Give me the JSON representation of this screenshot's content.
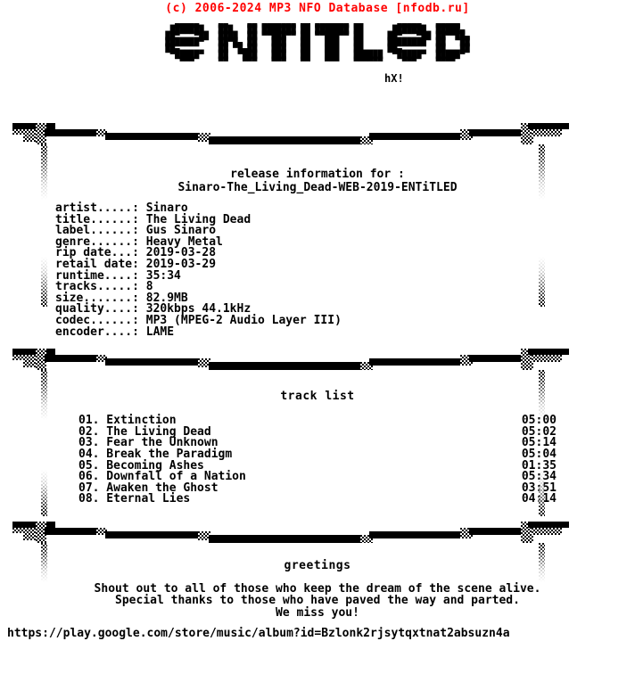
{
  "header": {
    "copyright": "(c) 2006-2024 MP3 NFO Database [nfodb.ru]",
    "color": "#ff0000"
  },
  "logo": {
    "group_name": "ENTiTLED",
    "signature": "hX!",
    "art": [
      "  ▄▄▄▄▄    ▄▄    ▄▄ ▄▄▄▄▄▄▄ ▄▄ ▄▄▄▄▄▄▄ ▄▄       ▄▄▄▄▄   ▄▄▄▄▄  ",
      " ███████   ███   ██ ███████ ██ ███████ ██      ███████  █████▄ ",
      "██▀   ▀██  ████  ██ ▀▀███▀▀ ██ ▀▀███▀▀ ██     ██▀   ▀██ ██▀▀██▄",
      "███████▀   ██▀█▄ ██   ███   ██   ███   ██     ████████  ██   ██",
      "██▄        ██ ▀█▄██   ███   ██   ███   ██     ██▄       ██   ██",
      " ▀█████▀   ██  ▀███   ███   ██   ███   ██████  ▀█████▀  █████▀ ",
      "   ▀▀▀     ▀▀   ▀▀▀   ▀▀▀   ▀▀   ▀▀▀   ▀▀▀▀▀▀    ▀▀▀    ▀▀▀▀   "
    ]
  },
  "release": {
    "section_label": "release information for :",
    "release_name": "Sinaro-The_Living_Dead-WEB-2019-ENTiTLED"
  },
  "info": {
    "rows": [
      {
        "key": "artist.....:",
        "value": "Sinaro"
      },
      {
        "key": "title......:",
        "value": "The Living Dead"
      },
      {
        "key": "label......:",
        "value": "Gus Sinaro"
      },
      {
        "key": "genre......:",
        "value": "Heavy Metal"
      },
      {
        "key": "rip date...:",
        "value": "2019-03-28"
      },
      {
        "key": "retail date:",
        "value": "2019-03-29"
      },
      {
        "key": "runtime....:",
        "value": "35:34"
      },
      {
        "key": "tracks.....:",
        "value": "8"
      },
      {
        "key": "size.......:",
        "value": "82.9MB"
      },
      {
        "key": "quality....:",
        "value": "320kbps 44.1kHz"
      },
      {
        "key": "codec......:",
        "value": "MP3 (MPEG-2 Audio Layer III)"
      },
      {
        "key": "encoder....:",
        "value": "LAME"
      }
    ]
  },
  "tracklist": {
    "section_label": "track list",
    "tracks": [
      {
        "num": "01.",
        "title": "Extinction",
        "time": "05:00"
      },
      {
        "num": "02.",
        "title": "The Living Dead",
        "time": "05:02"
      },
      {
        "num": "03.",
        "title": "Fear the Unknown",
        "time": "05:14"
      },
      {
        "num": "04.",
        "title": "Break the Paradigm",
        "time": "05:04"
      },
      {
        "num": "05.",
        "title": "Becoming Ashes",
        "time": "01:35"
      },
      {
        "num": "06.",
        "title": "Downfall of a Nation",
        "time": "05:34"
      },
      {
        "num": "07.",
        "title": "Awaken the Ghost",
        "time": "03:51"
      },
      {
        "num": "08.",
        "title": "Eternal Lies",
        "time": "04:14"
      }
    ]
  },
  "greetings": {
    "section_label": "greetings",
    "lines": [
      "Shout out to all of those who keep the dream of the scene alive.",
      "Special thanks to those who have paved the way and parted.",
      "We miss you!"
    ]
  },
  "footer": {
    "url": "https://play.google.com/store/music/album?id=Bzlonk2rjsytqxtnat2absuzn4a"
  }
}
